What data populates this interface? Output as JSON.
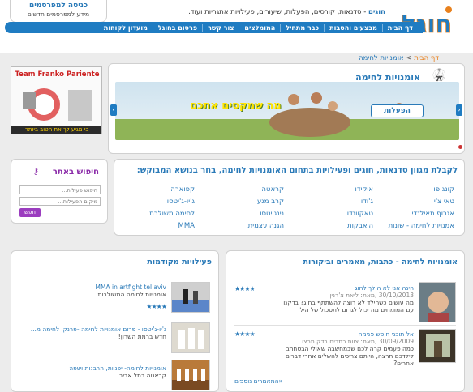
{
  "advertisers": {
    "login": "כניסה למפרסמים",
    "info": "מידע למפרסמים חדשים"
  },
  "brand": {
    "logo_text": "חוגל",
    "tagline_brand": "חוגים",
    "tagline": "- סדנאות, קורסים, הפעלות, שיעורים, פעילויות אתגריות ועוד."
  },
  "nav": {
    "items": [
      "דף הבית",
      "מבצעים והטבות",
      "כבר מתחיל",
      "המומלצים",
      "צור קשר",
      "פרסום בחוגל",
      "מועדון לקוחות"
    ]
  },
  "breadcrumb": {
    "home": "דף הבית",
    "separator": ">",
    "current": "אומנויות לחימה"
  },
  "side_ad": {
    "title": "Team Franko Pariente",
    "slogan": "כי מגיע לך את הטוב ביותר"
  },
  "hero": {
    "title": "אומנויות לחימה",
    "activities_label": "הפעלות",
    "promo": "מה שמקסים אתכם",
    "prev": "‹",
    "next": "›"
  },
  "search": {
    "title": "חיפוש באתר",
    "placeholder_activity": "חיפוש פעילות...",
    "placeholder_location": "מיקום הפעילות...",
    "button": "חפש"
  },
  "categories": {
    "title": "לקבלת מגוון סדנאות, חוגים ופעילויות בתחום האומנויות לחימה, בחר בנושא המבוקש:",
    "items": [
      "קונג פו",
      "איקידו",
      "קראטה",
      "קפוארה",
      "טאי צ'י",
      "ג'ודו",
      "קרב מגע",
      "ג'יו-ג'יטסו",
      "אגרוף תאילנדי",
      "טאקוונדו",
      "נינג'יטסו",
      "לחימה משולבת",
      "אמנויות לחימה - שונות",
      "היאבקות",
      "הגנה עצמית",
      "MMA"
    ]
  },
  "articles": {
    "title": "אומנויות לחימה - כתבות, מאמרים וביקורות",
    "items": [
      {
        "title": "הינה אני לא הולך לחוג",
        "date": "30/10/2013 ,מאת: ליאת צ'רנין",
        "body": "מה עושים כשהילד לא רוצה להשתתף בחוג? בדקנו עם המומחים מה יכול לגרום לתסכול של הילד",
        "rating": "★★★★"
      },
      {
        "title": "אל תוכני חופש פנימה",
        "date": "30/09/2009 ,מאת: צוות כתבים בדק תרצו",
        "body": "כמה פעמים קרה לכם שבמחשבה שאולי הבטחתם לילדכם תרצה, הייתם צריכים להשלים אחרי דברים אחרים?",
        "rating": "★★★★"
      }
    ],
    "more": "המאמרים נוספים»"
  },
  "featured": {
    "title": "פעילויות מקודמות",
    "items": [
      {
        "title": "MMA in artfight tel aviv",
        "sub": "אומנויות לחימה המשולבות",
        "rating": "★★★★"
      },
      {
        "title": "ג'יו-ג'יטסו - פרום אומנויות לחימה -פרנקו לחימה מ...",
        "sub": "חדש ברמת השרון!",
        "rating": ""
      },
      {
        "title": "אומנויות לחימה- יפניות, הרבנות ושפה",
        "sub": "קראטה בתל אביב",
        "rating": ""
      }
    ]
  },
  "colors": {
    "brand_blue": "#1f7cc2",
    "accent_purple": "#9b3dbf",
    "accent_orange": "#e8811e"
  }
}
